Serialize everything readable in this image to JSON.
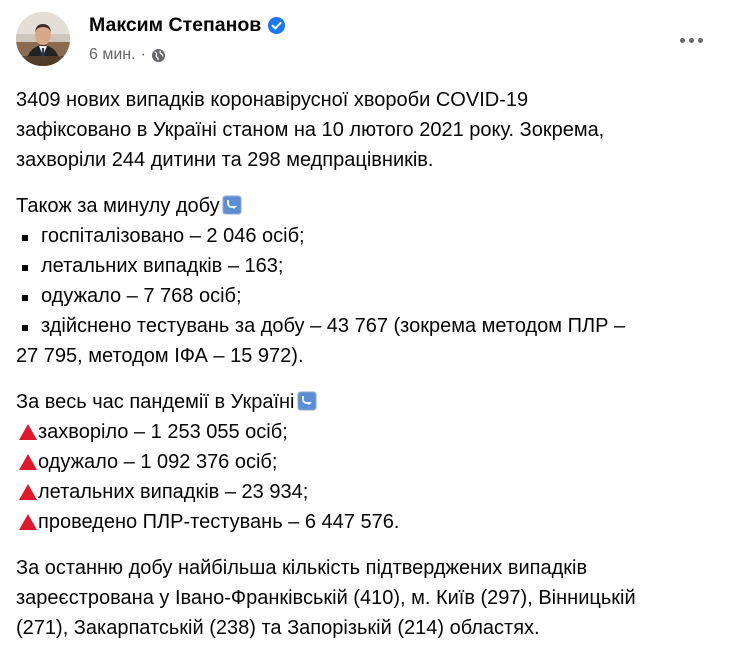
{
  "header": {
    "author_name": "Максим Степанов",
    "timestamp": "6 мин.",
    "separator": "·",
    "verified_icon": "verified-badge-icon",
    "privacy_icon": "globe-icon",
    "more_icon": "more-options-icon"
  },
  "post": {
    "intro_lines": [
      "3409 нових випадків коронавірусної хвороби COVID-19",
      "зафіксовано в Україні станом на 10 лютого 2021 року. Зокрема,",
      "захворіли 244 дитини та 298 медпрацівників."
    ],
    "daily_heading": "Також за минулу добу",
    "daily_items": [
      "госпіталізовано – 2 046 осіб;",
      "летальних випадків – 163;",
      "одужало – 7 768 осіб;",
      "здійснено тестувань за добу – 43 767 (зокрема методом ПЛР –"
    ],
    "daily_item_continuation": "27 795, методом ІФА – 15 972).",
    "pandemic_heading": "За весь час пандемії в Україні",
    "pandemic_items": [
      "захворіло – 1 253 055 осіб;",
      "одужало – 1 092 376 осіб;",
      "летальних випадків – 23 934;",
      "проведено ПЛР-тестувань – 6 447 576."
    ],
    "regions_lines": [
      "За останню добу найбільша кількість підтверджених випадків",
      "зареєстрована у Івано-Франківській (410), м. Київ (297), Вінницькій",
      "(271), Закарпатській (238) та Запорізькій (214) областях."
    ]
  },
  "colors": {
    "text": "#050505",
    "secondary_text": "#65676b",
    "verified_blue": "#1877f2",
    "triangle_red": "#e0182d",
    "emoji_blue": "#5a8fd6"
  }
}
